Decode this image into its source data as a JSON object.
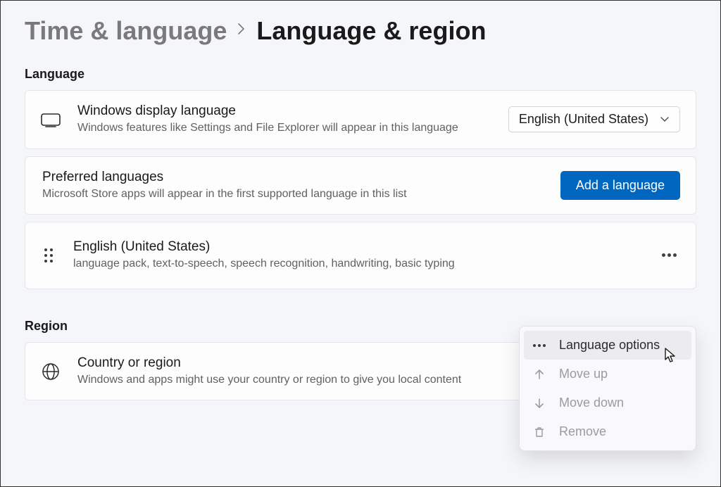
{
  "breadcrumb": {
    "parent": "Time & language",
    "current": "Language & region"
  },
  "sections": {
    "language_header": "Language",
    "region_header": "Region"
  },
  "display_language": {
    "title": "Windows display language",
    "subtitle": "Windows features like Settings and File Explorer will appear in this language",
    "selected": "English (United States)"
  },
  "preferred_languages": {
    "title": "Preferred languages",
    "subtitle": "Microsoft Store apps will appear in the first supported language in this list",
    "add_button": "Add a language",
    "items": [
      {
        "name": "English (United States)",
        "features": "language pack, text-to-speech, speech recognition, handwriting, basic typing"
      }
    ]
  },
  "region": {
    "title": "Country or region",
    "subtitle": "Windows and apps might use your country or region to give you local content"
  },
  "context_menu": {
    "language_options": "Language options",
    "move_up": "Move up",
    "move_down": "Move down",
    "remove": "Remove"
  }
}
